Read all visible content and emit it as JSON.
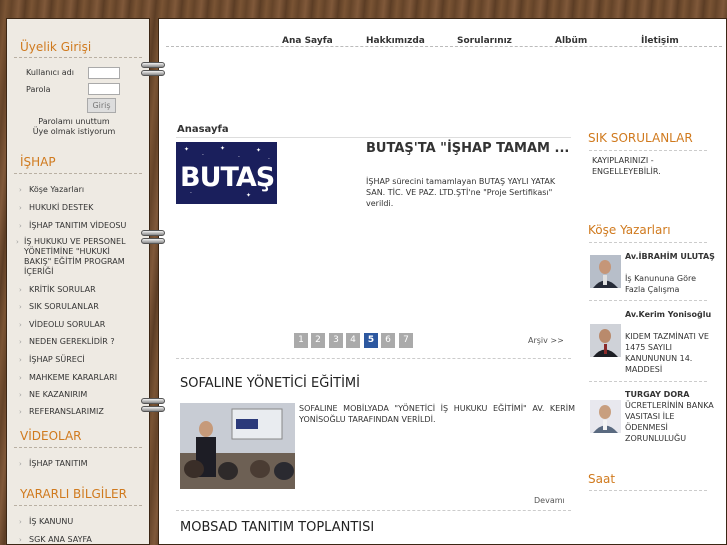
{
  "nav": {
    "items": [
      "Ana Sayfa",
      "Hakkımızda",
      "Sorularınız",
      "Albüm",
      "İletişim"
    ]
  },
  "login": {
    "title": "Üyelik Girişi",
    "username_label": "Kullanıcı adı",
    "password_label": "Parola",
    "submit_label": "Giriş",
    "forgot": "Parolamı unuttum",
    "register": "Üye olmak istiyorum"
  },
  "ishap": {
    "title": "İŞHAP",
    "items": [
      "Köşe Yazarları",
      "HUKUKİ DESTEK",
      "İŞHAP TANITIM VİDEOSU",
      "İŞ HUKUKU VE PERSONEL YÖNETİMİNE \"HUKUKİ BAKIŞ\" EĞİTİM PROGRAM İÇERİĞİ",
      "KRİTİK SORULAR",
      "SIK SORULANLAR",
      "VİDEOLU SORULAR",
      "NEDEN GEREKLİDİR ?",
      "İŞHAP SÜRECİ",
      "MAHKEME KARARLARI",
      "NE KAZANIRIM",
      "REFERANSLARIMIZ"
    ]
  },
  "videolar": {
    "title": "VİDEOLAR",
    "items": [
      "İŞHAP TANITIM"
    ]
  },
  "yararli": {
    "title": "YARARLI BİLGİLER",
    "items": [
      "İŞ KANUNU",
      "SGK ANA SAYFA"
    ]
  },
  "main": {
    "breadcrumb": "Anasayfa",
    "slide": {
      "logo_text": "BUTAŞ",
      "title": "BUTAŞ'TA \"İŞHAP TAMAM ...",
      "desc": "İŞHAP sürecini tamamlayan BUTAŞ YAYLI YATAK SAN. TİC. VE PAZ. LTD.ŞTİ'ne \"Proje Sertifikası\" verildi."
    },
    "pager": [
      "1",
      "2",
      "3",
      "4",
      "5",
      "6",
      "7"
    ],
    "pager_active": "5",
    "arsiv": "Arşiv >>",
    "news": [
      {
        "title": "SOFALINE YÖNETİCİ EĞİTİMİ",
        "text": "SOFALINE MOBİLYADA \"YÖNETİCİ İŞ HUKUKU EĞİTİMİ\" AV. KERİM YONİSOĞLU TARAFINDAN VERİLDİ.",
        "more": "Devamı"
      },
      {
        "title": "MOBSAD TANITIM TOPLANTISI"
      }
    ]
  },
  "right": {
    "sik_title": "SIK SORULANLAR",
    "sik_text": "KAYIPLARINIZI - ENGELLEYEBİLİR.",
    "kose_title": "Köşe Yazarları",
    "authors": [
      {
        "name": "Av.İBRAHİM ULUTAŞ",
        "desc": "İş Kanununa Göre Fazla Çalışma"
      },
      {
        "name": "Av.Kerim Yonisoğlu",
        "desc": "KIDEM TAZMİNATI VE 1475 SAYILI KANUNUNUN 14. MADDESİ"
      },
      {
        "name": "TURGAY DORA",
        "desc": "ÜCRETLERİNİN BANKA VASITASI İLE ÖDENMESİ ZORUNLULUĞU"
      }
    ],
    "saat_title": "Saat"
  },
  "colors": {
    "accent": "#d07a1e",
    "pager_active": "#2d58a0",
    "wood": "#6b4a2e"
  }
}
